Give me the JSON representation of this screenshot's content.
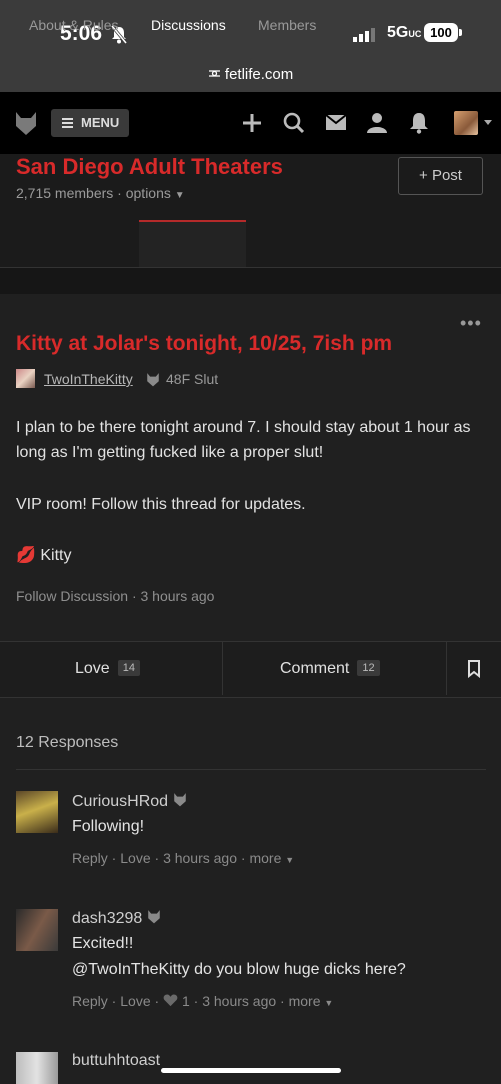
{
  "status_bar": {
    "time": "5:06",
    "network": "5G",
    "network_suffix": "UC",
    "battery": "100",
    "url": "fetlife.com"
  },
  "nav": {
    "menu_label": "MENU"
  },
  "group": {
    "title": "San Diego Adult Theaters",
    "members": "2,715 members",
    "options": "options",
    "post_label": "+ Post"
  },
  "tabs": [
    "About & Rules",
    "Discussions",
    "Members"
  ],
  "discussion": {
    "title": "Kitty at Jolar's tonight, 10/25, 7ish pm",
    "author": "TwoInTheKitty",
    "author_meta": "48F Slut",
    "paragraphs": [
      "I plan to be there tonight around 7. I should stay about 1 hour as long as I'm getting fucked like a proper slut!",
      "VIP room! Follow this thread for updates."
    ],
    "signature_emoji": "💋",
    "signature": "Kitty",
    "follow": "Follow Discussion",
    "posted": "3 hours ago"
  },
  "actions": {
    "love_label": "Love",
    "love_count": "14",
    "comment_label": "Comment",
    "comment_count": "12"
  },
  "responses": {
    "heading": "12 Responses",
    "comments": [
      {
        "name": "CuriousHRod",
        "text": "Following!",
        "reply": "Reply",
        "love": "Love",
        "time": "3 hours ago",
        "more": "more"
      },
      {
        "name": "dash3298",
        "text": "Excited!!",
        "text2": "@TwoInTheKitty do you blow huge dicks here?",
        "reply": "Reply",
        "love": "Love",
        "love_count": "1",
        "time": "3 hours ago",
        "more": "more"
      },
      {
        "name": "buttuhhtoast"
      }
    ]
  },
  "colors": {
    "accent": "#d82a2a",
    "nav_bg": "#000000",
    "page_bg": "#1b1b1b"
  }
}
